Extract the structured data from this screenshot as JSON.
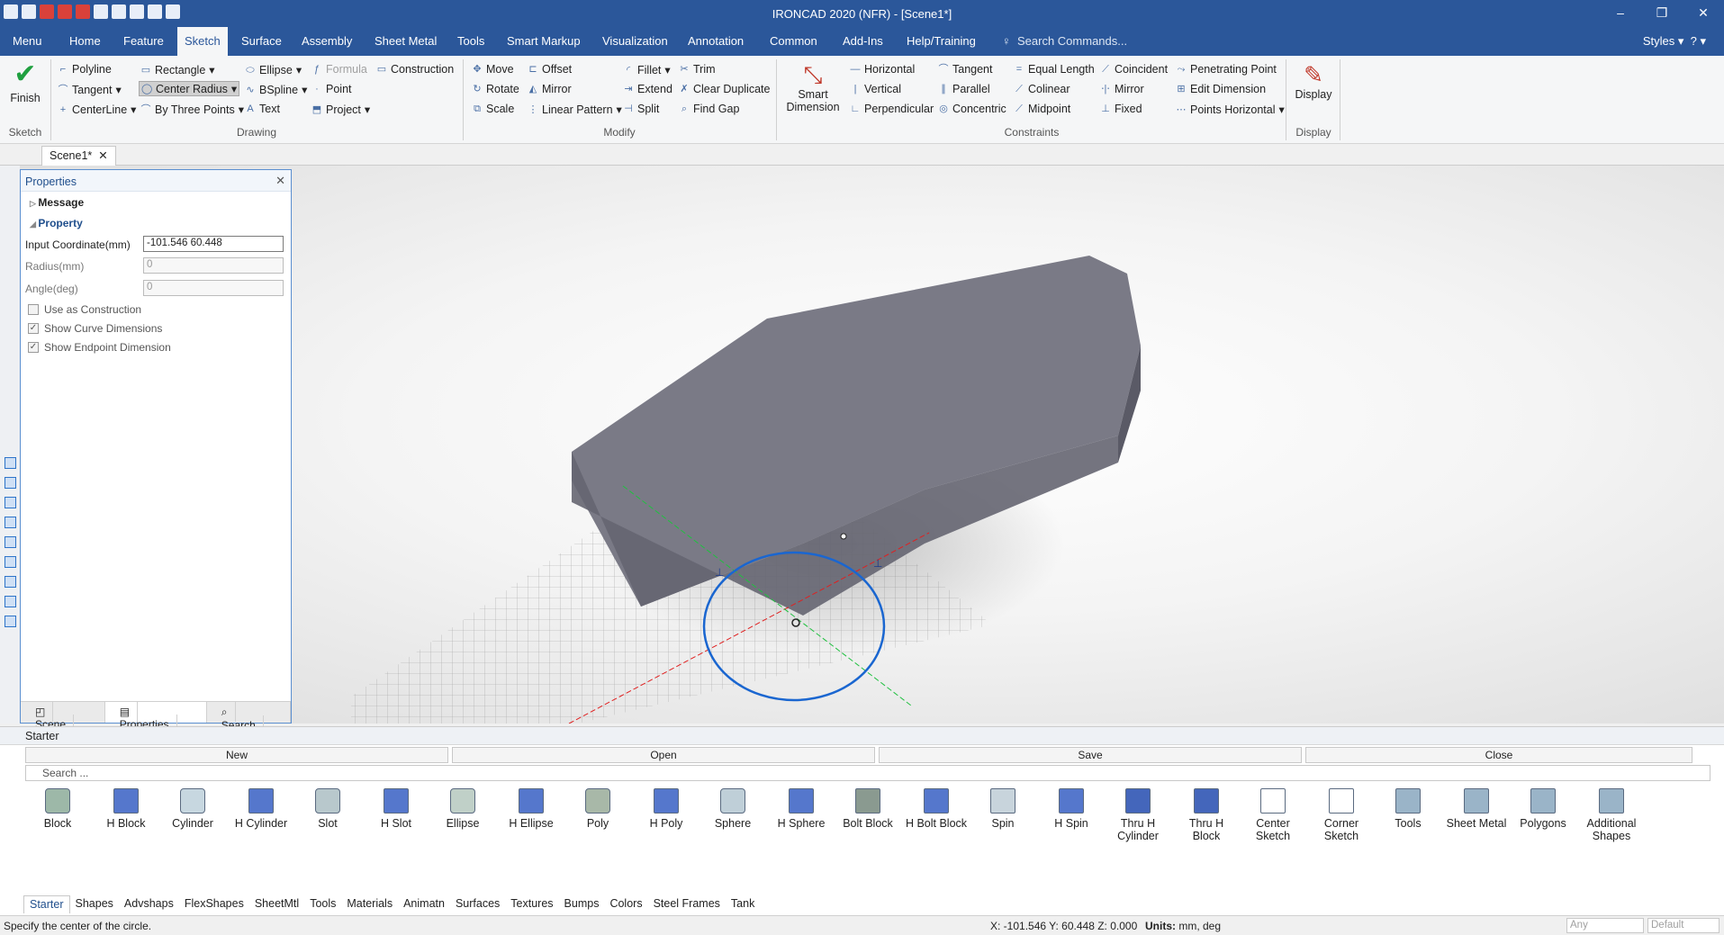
{
  "titlebar": {
    "title": "IRONCAD 2020 (NFR) - [Scene1*]",
    "min": "–",
    "restore": "❐",
    "close": "✕"
  },
  "menubar": {
    "tabs": [
      "Menu",
      "Home",
      "Feature",
      "Sketch",
      "Surface",
      "Assembly",
      "Sheet Metal",
      "Tools",
      "Smart Markup",
      "Visualization",
      "Annotation",
      "Common",
      "Add-Ins",
      "Help/Training"
    ],
    "active_tab": "Sketch",
    "search_placeholder": "Search Commands...",
    "styles": "Styles"
  },
  "ribbon": {
    "finish": "Finish",
    "sketch_group": "Sketch",
    "drawing": {
      "polyline": "Polyline",
      "tangent": "Tangent",
      "centerline": "CenterLine",
      "rectangle": "Rectangle",
      "center_radius": "Center Radius",
      "by_three_points": "By Three Points",
      "ellipse": "Ellipse",
      "bspline": "BSpline",
      "text": "Text",
      "formula": "Formula",
      "point": "Point",
      "project": "Project",
      "construction": "Construction",
      "label": "Drawing"
    },
    "modify": {
      "move": "Move",
      "rotate": "Rotate",
      "scale": "Scale",
      "offset": "Offset",
      "mirror": "Mirror",
      "linear_pattern": "Linear Pattern",
      "fillet": "Fillet",
      "extend": "Extend",
      "split": "Split",
      "trim": "Trim",
      "clear_duplicate": "Clear Duplicate",
      "find_gap": "Find Gap",
      "label": "Modify"
    },
    "smart_dimension": "Smart Dimension",
    "constraints": {
      "horizontal": "Horizontal",
      "vertical": "Vertical",
      "perpendicular": "Perpendicular",
      "tangent": "Tangent",
      "parallel": "Parallel",
      "concentric": "Concentric",
      "equal_length": "Equal Length",
      "colinear": "Colinear",
      "midpoint": "Midpoint",
      "coincident": "Coincident",
      "mirror": "Mirror",
      "fixed": "Fixed",
      "penetrating_point": "Penetrating Point",
      "edit_dimension": "Edit Dimension",
      "points_horizontal": "Points Horizontal",
      "label": "Constraints"
    },
    "display": "Display",
    "display_group": "Display"
  },
  "doc_tab": "Scene1*",
  "properties": {
    "title": "Properties",
    "message": "Message",
    "property": "Property",
    "input_coordinate_label": "Input Coordinate(mm)",
    "input_coordinate_value": "-101.546 60.448",
    "radius_label": "Radius(mm)",
    "radius_value": "0",
    "angle_label": "Angle(deg)",
    "angle_value": "0",
    "use_construction": "Use as Construction",
    "show_curve_dims": "Show Curve Dimensions",
    "show_endpoint_dim": "Show Endpoint Dimension",
    "tabs": [
      "Scene",
      "Properties",
      "Search"
    ]
  },
  "catalog": {
    "title": "Starter",
    "new": "New",
    "open": "Open",
    "save": "Save",
    "close": "Close",
    "search_placeholder": "Search ...",
    "items": [
      "Block",
      "H Block",
      "Cylinder",
      "H Cylinder",
      "Slot",
      "H Slot",
      "Ellipse",
      "H Ellipse",
      "Poly",
      "H Poly",
      "Sphere",
      "H Sphere",
      "Bolt Block",
      "H Bolt Block",
      "Spin",
      "H Spin",
      "Thru H Cylinder",
      "Thru H Block",
      "Center Sketch",
      "Corner Sketch",
      "Tools",
      "Sheet Metal",
      "Polygons",
      "Additional Shapes"
    ],
    "tabs": [
      "Starter",
      "Shapes",
      "Advshaps",
      "FlexShapes",
      "SheetMtl",
      "Tools",
      "Materials",
      "Animatn",
      "Surfaces",
      "Textures",
      "Bumps",
      "Colors",
      "Steel Frames",
      "Tank"
    ]
  },
  "status": {
    "message": "Specify the center of the circle.",
    "coords": "X: -101.546 Y: 60.448 Z: 0.000",
    "units_label": "Units:",
    "units_value": "mm, deg",
    "combo1": "Any",
    "combo2": "Default"
  }
}
